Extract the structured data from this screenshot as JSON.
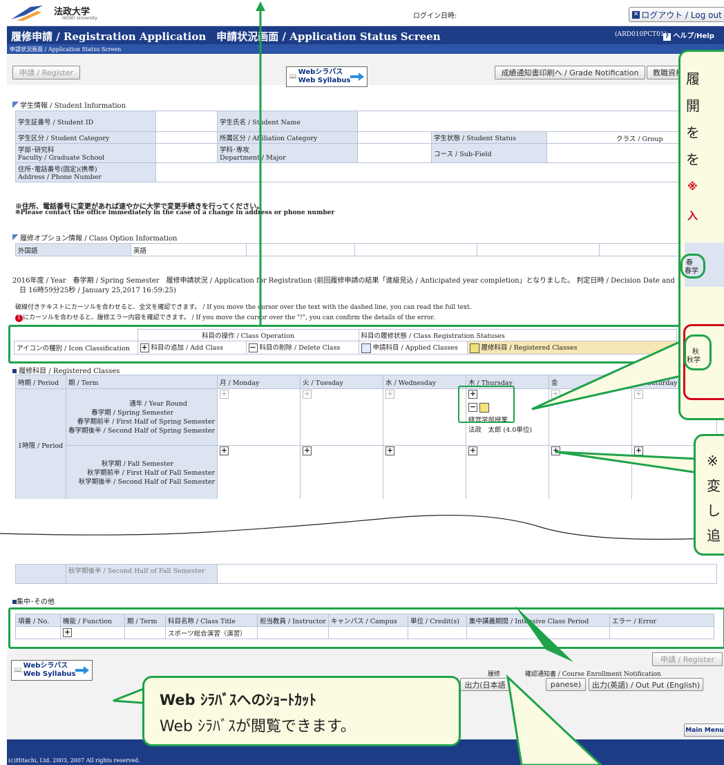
{
  "header": {
    "logo_text": "法政大学",
    "logo_sub": "HOSEI University",
    "login_label": "ログイン日時:",
    "logout_label": "ログアウト / Log out",
    "title": "履修申請 / Registration Application　申請状況画面 / Application Status Screen",
    "screen_id": "(ARD010PCT01)",
    "help_label": "ヘルプ/Help",
    "breadcrumb": "申請状況画面 / Application Status Screen"
  },
  "toolbar": {
    "register_label": "申請 / Register",
    "syllabus_jp": "Webシラバス",
    "syllabus_en": "Web Syllabus",
    "grade_label": "成績通知書印刷へ / Grade Notification",
    "teacher_label": "教職資格"
  },
  "student_info": {
    "section": "学生情報 / Student Information",
    "id_label": "学生証番号 / Student ID",
    "name_label": "学生氏名 / Student Name",
    "category_label": "学生区分 / Student Category",
    "affiliation_label": "所属区分 / Affiliation Category",
    "status_label": "学生状態 / Student Status",
    "group_label": "クラス / Group",
    "faculty_label": "学部･研究科",
    "faculty_label_en": "Faculty / Graduate School",
    "dept_label": "学科･専攻",
    "dept_label_en": "Department / Major",
    "course_label": "コース / Sub-Field",
    "address_label": "住所･電話番号(固定)(携帯)",
    "address_label_en": "Address / Phone Number",
    "notice_jp": "※住所、電話番号に変更があれば速やかに大学で変更手続きを行ってください。",
    "notice_en": "※Please contact the office immediately in the case of a change in address or phone number"
  },
  "class_option": {
    "section": "履修オプション情報 / Class Option Information",
    "lang_label": "外国語",
    "lang_value": "英語"
  },
  "status": {
    "line1": "2016年度 / Year　春学期 / Spring Semester　履修申請状況 / Application for Registration (前回履修申請の結果「進級見込 / Anticipated year completion」となりました。 判定日時 / Decision Date and Time",
    "line2": "日 16時59分25秒 / January 25,2017 16:59:25)",
    "hint1": "破線付きテキストにカーソルを合わせると、全文を確認できます。 / If you move the cursor over the text with the dashed line, you can read the full text.",
    "hint2": "にカーソルを合わせると、履修エラー内容を確認できます。 / If you move the cursor over the \"!\", you can confirm the details of the error."
  },
  "legend": {
    "ops_header": "科目の操作 / Class Operation",
    "status_header": "科目の履修状態 / Class Registration Statuses",
    "row_label": "アイコンの種別 / Icon Classification",
    "add": "科目の追加 / Add Class",
    "delete": "科目の削除 / Delete Class",
    "applied": "申請科目 / Applied Classes",
    "registered": "履修科目 / Registered Classes"
  },
  "timetable": {
    "section": "履修科目 / Registered Classes",
    "col_period": "時期 / Period",
    "col_term": "期 / Term",
    "days": [
      "月 / Monday",
      "火 / Tuesday",
      "水 / Wednesday",
      "木 / Thursday",
      "金",
      "土 / Saturday"
    ],
    "period_label": "1時限 / Period",
    "terms_a": [
      "通年 / Year Round",
      "春学期 / Spring Semester",
      "春学期前半 / First Half of Spring Semester",
      "春学期後半 / Second Half of Spring Semester"
    ],
    "terms_b": [
      "秋学期 / Fall Semester",
      "秋学期前半 / First Half of Fall Semester",
      "秋学期後半 / Second Half of Fall Semester"
    ],
    "class_name": "経営学部授業",
    "class_teacher": "法政　太郎",
    "class_credit": "(4.0単位)",
    "cut_term": "秋学期後半 / Second Half of Fall Semester"
  },
  "intensive": {
    "section": "集中･その他",
    "headers": [
      "項番 / No.",
      "機能 / Function",
      "期 / Term",
      "科目名称 / Class Title",
      "担当教員 / Instructor",
      "キャンパス / Campus",
      "単位 / Credit(s)",
      "集中講義期間 / Intensive Class Period",
      "エラー / Error"
    ],
    "class_title": "スポーツ総合演習（演習）"
  },
  "bottom": {
    "register_label": "申請 / Register",
    "notification": "履修　　　　確認通知書 / Course Enrollment Notification",
    "out_jp": "出力(日本語",
    "out_jp2": "panese)",
    "out_en": "出力(英語) / Out Put (English)",
    "main_menu": "Main Menu",
    "copyright": "(c)Hitachi, Ltd. 2003, 2007 All rights reserved."
  },
  "callouts": {
    "right_lines": [
      "履",
      "開",
      "を",
      "を"
    ],
    "right_red1": "※",
    "right_red2": "入",
    "right_inner1a": "春",
    "right_inner1b": "春学",
    "right_inner2a": "秋",
    "right_inner2b": "秋学",
    "side_lines": [
      "※",
      "変",
      "し",
      "追"
    ],
    "syllabus_title": "Web ｼﾗﾊﾞｽへのｼｮｰﾄｶｯﾄ",
    "syllabus_body": "Web ｼﾗﾊﾞｽが閲覧できます。"
  },
  "colors": {
    "header_blue": "#1d3c86",
    "accent_green": "#1fa24a",
    "callout_bg": "#fbfbe1",
    "label_bg": "#dce4f2"
  }
}
